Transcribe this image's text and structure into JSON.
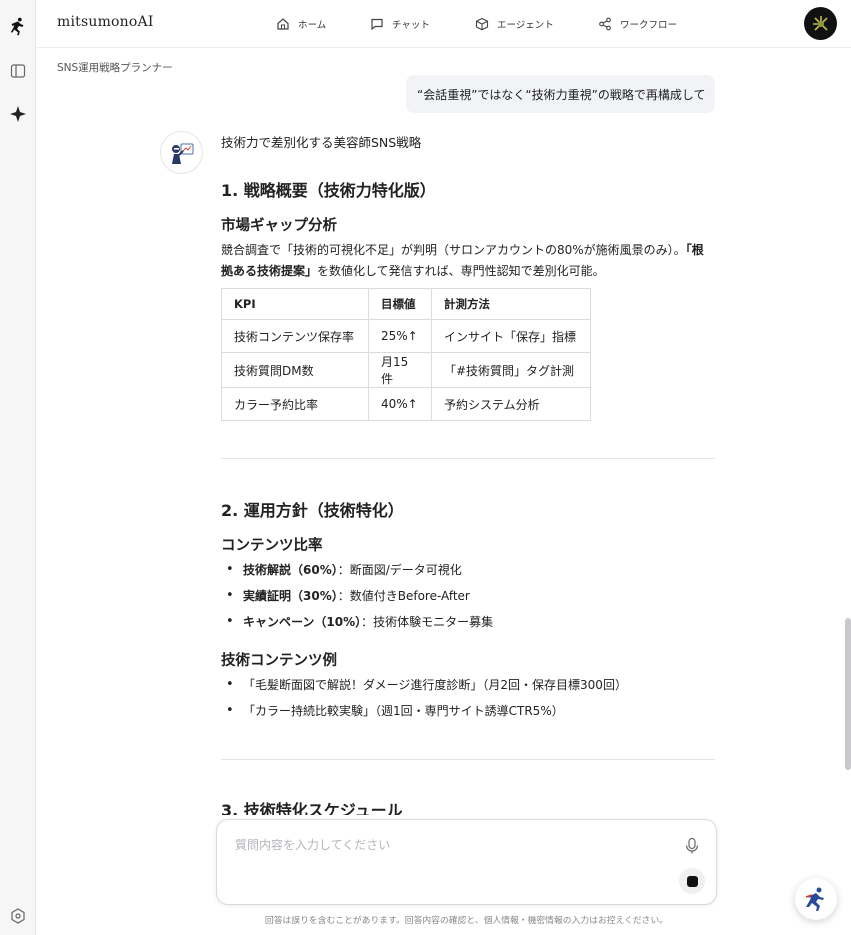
{
  "app": {
    "brand": "mitsumonoAI"
  },
  "nav": {
    "home": "ホーム",
    "chat": "チャット",
    "agent": "エージェント",
    "workflow": "ワークフロー"
  },
  "breadcrumb": "SNS運用戦略プランナー",
  "user_message": "“会話重視”ではなく“技術力重視”の戦略で再構成して",
  "answer": {
    "intro": "技術力で差別化する美容師SNS戦略",
    "s1_title": "1. 戦略概要（技術力特化版）",
    "s1_sub": "市場ギャップ分析",
    "s1_para_a": "競合調査で「技術的可視化不足」が判明（サロンアカウントの80%が施術風景のみ）。",
    "s1_para_bold": "「根拠ある技術提案」",
    "s1_para_b": "を数値化して発信すれば、専門性認知で差別化可能。",
    "table": {
      "headers": [
        "KPI",
        "目標値",
        "計測方法"
      ],
      "rows": [
        [
          "技術コンテンツ保存率",
          "25%↑",
          "インサイト「保存」指標"
        ],
        [
          "技術質問DM数",
          "月15件",
          "「#技術質問」タグ計測"
        ],
        [
          "カラー予約比率",
          "40%↑",
          "予約システム分析"
        ]
      ]
    },
    "s2_title": "2. 運用方針（技術特化）",
    "s2_sub1": "コンテンツ比率",
    "ratio": [
      {
        "label": "技術解説（60%）",
        "text": "：断面図/データ可視化"
      },
      {
        "label": "実績証明（30%）",
        "text": "：数値付きBefore-After"
      },
      {
        "label": "キャンペーン（10%）",
        "text": "：技術体験モニター募集"
      }
    ],
    "s2_sub2": "技術コンテンツ例",
    "examples": [
      "「毛髪断面図で解説！ダメージ進行度診断」（月2回・保存目標300回）",
      "「カラー持続比較実験」（週1回・専門サイト誘導CTR5%）"
    ],
    "s3_title": "3. 技術特化スケジュール"
  },
  "input": {
    "placeholder": "質問内容を入力してください"
  },
  "disclaimer": "回答は誤りを含むことがあります。回答内容の確認と、個人情報・機密情報の入力はお控えください。"
}
